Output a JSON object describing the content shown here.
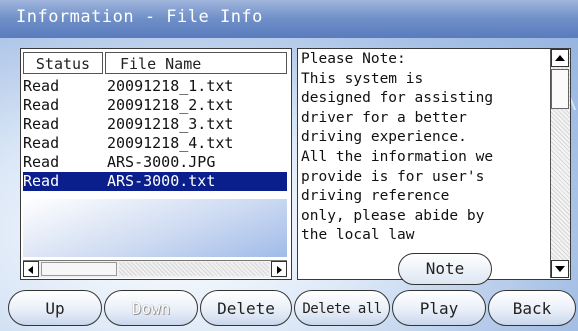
{
  "window": {
    "title": "Information - File Info"
  },
  "file_list": {
    "columns": [
      "Status",
      "File Name"
    ],
    "rows": [
      {
        "status": "Read",
        "file_name": "20091218_1.txt"
      },
      {
        "status": "Read",
        "file_name": "20091218_2.txt"
      },
      {
        "status": "Read",
        "file_name": "20091218_3.txt"
      },
      {
        "status": "Read",
        "file_name": "20091218_4.txt"
      },
      {
        "status": "Read",
        "file_name": "ARS-3000.JPG"
      },
      {
        "status": "Read",
        "file_name": "ARS-3000.txt"
      }
    ],
    "selected_index": 5
  },
  "note_panel": {
    "lines": [
      "Please Note:",
      "  This system is",
      "designed for assisting",
      "driver for a better",
      "driving experience.",
      "All the information we",
      "provide is for user's",
      " driving reference",
      "only, please abide by",
      "the local       law"
    ],
    "note_button": "Note"
  },
  "toolbar": {
    "up": "Up",
    "down": "Down",
    "delete": "Delete",
    "delete_all": "Delete all",
    "play": "Play",
    "back": "Back"
  },
  "colors": {
    "title_bar": "#6f8fc8",
    "selection": "#0a1f8c",
    "background": "#a9c2e6"
  }
}
